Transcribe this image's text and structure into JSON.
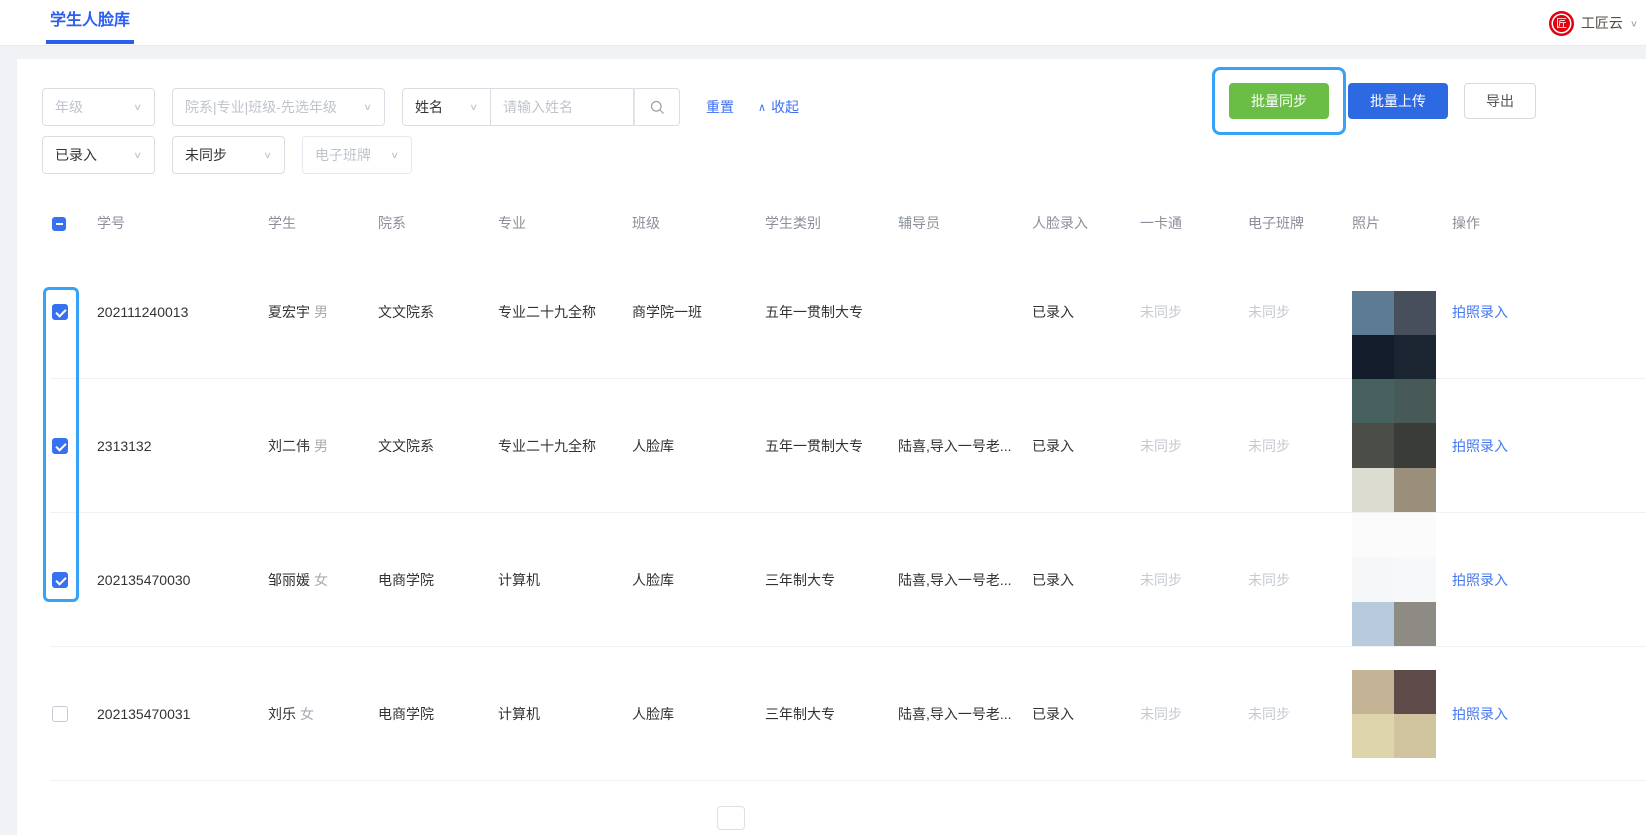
{
  "header": {
    "tab": "学生人脸库",
    "logo_char": "匠",
    "user_name": "工匠云",
    "user_chevron": "∨"
  },
  "filters": {
    "grade_placeholder": "年级",
    "dept_placeholder": "院系|专业|班级-先选年级",
    "name_type_value": "姓名",
    "name_placeholder": "请输入姓名",
    "reset_label": "重置",
    "collapse_label": "收起",
    "collapse_chevron": "∧",
    "select_chevron": "∨",
    "face_status_value": "已录入",
    "sync_status_value": "未同步",
    "eclass_placeholder": "电子班牌"
  },
  "toolbar": {
    "batch_sync_label": "批量同步",
    "batch_upload_label": "批量上传",
    "export_label": "导出",
    "batch_sync_color": "#6bbe45",
    "batch_upload_color": "#2c69e3"
  },
  "annotations": {
    "highlight_color": "#36a3f7",
    "highlighted": [
      "batch-sync-button",
      "row-checkboxes-1-3"
    ]
  },
  "table": {
    "select_all_state": "indeterminate",
    "columns": [
      "学号",
      "学生",
      "院系",
      "专业",
      "班级",
      "学生类别",
      "辅导员",
      "人脸录入",
      "一卡通",
      "电子班牌",
      "照片",
      "操作"
    ],
    "rows": [
      {
        "checked": true,
        "student_id": "202111240013",
        "name": "夏宏宇",
        "gender": "男",
        "dept": "文文院系",
        "major": "专业二十九全称",
        "class": "商学院一班",
        "type": "五年一贯制大专",
        "counselor": "",
        "face_status": "已录入",
        "card_status": "未同步",
        "eclass_status": "未同步",
        "action": "拍照录入",
        "photo_blocks": [
          [
            "#5d7b92",
            "#474f5c"
          ],
          [
            "#131d2c",
            "#1b2531"
          ]
        ]
      },
      {
        "checked": true,
        "student_id": "2313132",
        "name": "刘二伟",
        "gender": "男",
        "dept": "文文院系",
        "major": "专业二十九全称",
        "class": "人脸库",
        "type": "五年一贯制大专",
        "counselor": "陆喜,导入一号老...",
        "face_status": "已录入",
        "card_status": "未同步",
        "eclass_status": "未同步",
        "action": "拍照录入",
        "photo_blocks": [
          [
            "#46615f",
            "#475a57"
          ],
          [
            "#4a4e47",
            "#3a3c39"
          ],
          [
            "#dcddd0",
            "#9a8f7b"
          ]
        ]
      },
      {
        "checked": true,
        "student_id": "202135470030",
        "name": "邹丽媛",
        "gender": "女",
        "dept": "电商学院",
        "major": "计算机",
        "class": "人脸库",
        "type": "三年制大专",
        "counselor": "陆喜,导入一号老...",
        "face_status": "已录入",
        "card_status": "未同步",
        "eclass_status": "未同步",
        "action": "拍照录入",
        "photo_blocks": [
          [
            "#fbfbfc",
            "#fbfbfc"
          ],
          [
            "#f6f7f8",
            "#f7f8f9"
          ],
          [
            "#b8cbdd",
            "#8e8a84"
          ]
        ]
      },
      {
        "checked": false,
        "student_id": "202135470031",
        "name": "刘乐",
        "gender": "女",
        "dept": "电商学院",
        "major": "计算机",
        "class": "人脸库",
        "type": "三年制大专",
        "counselor": "陆喜,导入一号老...",
        "face_status": "已录入",
        "card_status": "未同步",
        "eclass_status": "未同步",
        "action": "拍照录入",
        "photo_blocks": [
          [
            "#c4b394",
            "#5d4a49"
          ],
          [
            "#ded5ad",
            "#cfc49d"
          ]
        ]
      }
    ]
  }
}
